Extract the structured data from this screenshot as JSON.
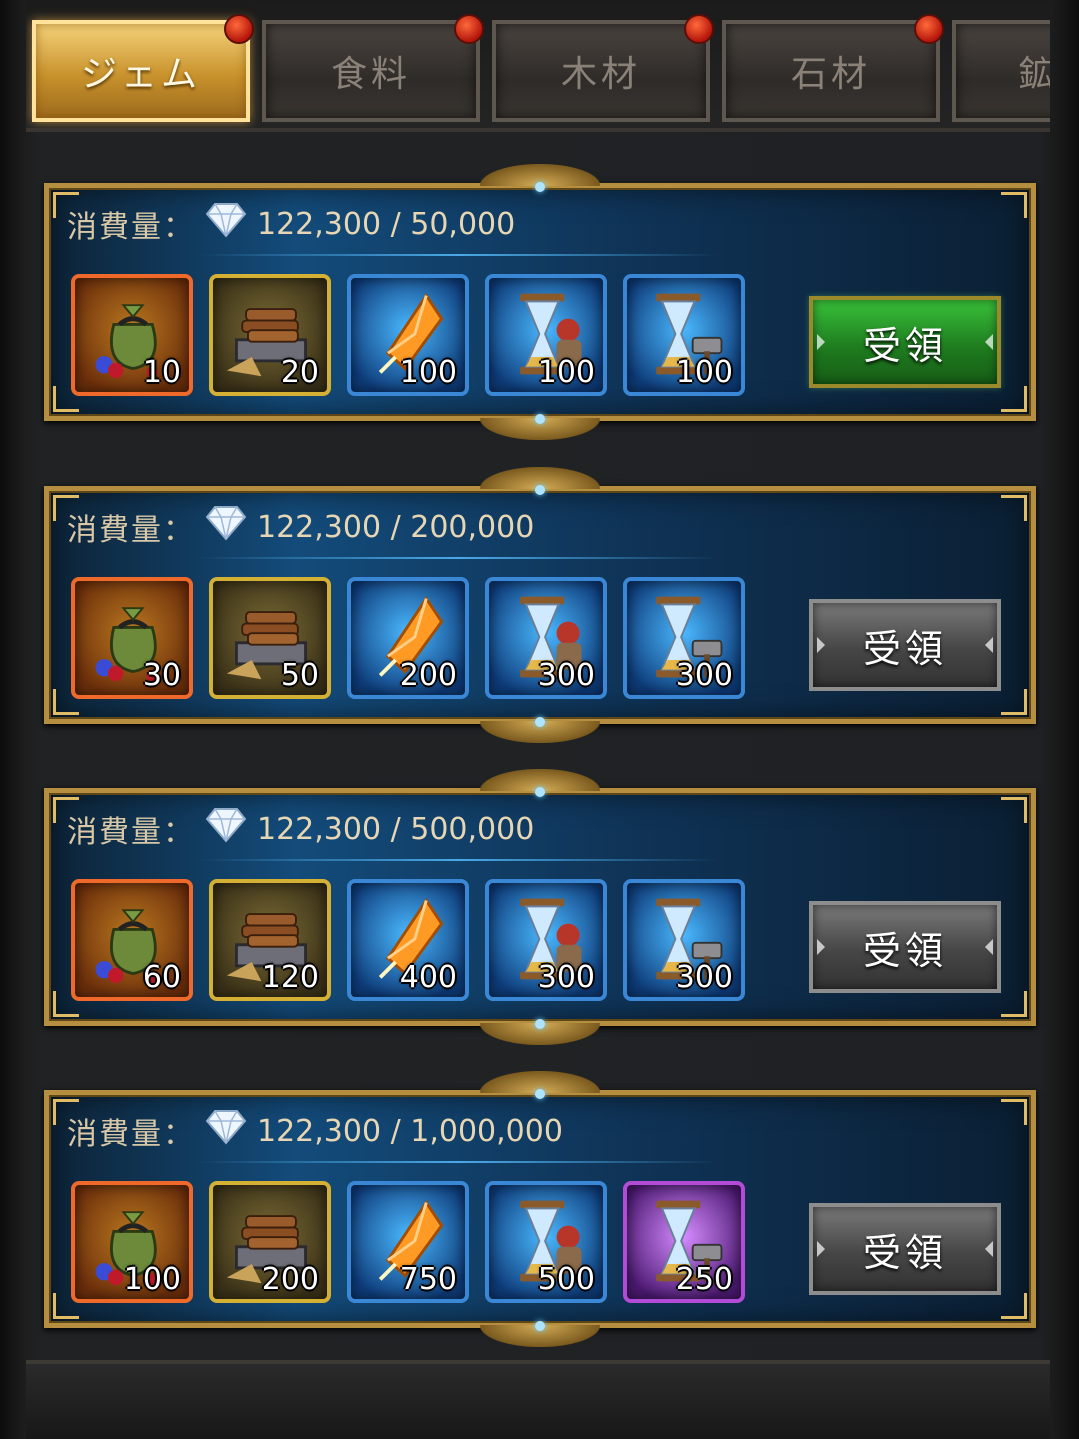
{
  "tabs": [
    {
      "label": "ジェム",
      "active": true,
      "badge": true
    },
    {
      "label": "食料",
      "active": false,
      "badge": true
    },
    {
      "label": "木材",
      "active": false,
      "badge": true
    },
    {
      "label": "石材",
      "active": false,
      "badge": true
    },
    {
      "label": "鉱",
      "active": false,
      "badge": false
    }
  ],
  "consume_label": "消費量：",
  "claim_label": "受領",
  "tiers": [
    {
      "progress": "122,300 / 50,000",
      "claim_enabled": true,
      "rewards": [
        {
          "icon": "resource-bag-icon",
          "rarity": "orange",
          "qty": "10"
        },
        {
          "icon": "lumber-cart-icon",
          "rarity": "gold",
          "qty": "20"
        },
        {
          "icon": "orange-crystal-icon",
          "rarity": "blue",
          "qty": "100"
        },
        {
          "icon": "training-speedup-hourglass-icon",
          "rarity": "blue",
          "qty": "100"
        },
        {
          "icon": "building-speedup-hourglass-icon",
          "rarity": "blue",
          "qty": "100"
        }
      ]
    },
    {
      "progress": "122,300 / 200,000",
      "claim_enabled": false,
      "rewards": [
        {
          "icon": "resource-bag-icon",
          "rarity": "orange",
          "qty": "30"
        },
        {
          "icon": "lumber-cart-icon",
          "rarity": "gold",
          "qty": "50"
        },
        {
          "icon": "orange-crystal-icon",
          "rarity": "blue",
          "qty": "200"
        },
        {
          "icon": "training-speedup-hourglass-icon",
          "rarity": "blue",
          "qty": "300"
        },
        {
          "icon": "building-speedup-hourglass-icon",
          "rarity": "blue",
          "qty": "300"
        }
      ]
    },
    {
      "progress": "122,300 / 500,000",
      "claim_enabled": false,
      "rewards": [
        {
          "icon": "resource-bag-icon",
          "rarity": "orange",
          "qty": "60"
        },
        {
          "icon": "lumber-cart-icon",
          "rarity": "gold",
          "qty": "120"
        },
        {
          "icon": "orange-crystal-icon",
          "rarity": "blue",
          "qty": "400"
        },
        {
          "icon": "training-speedup-hourglass-icon",
          "rarity": "blue",
          "qty": "300"
        },
        {
          "icon": "building-speedup-hourglass-icon",
          "rarity": "blue",
          "qty": "300"
        }
      ]
    },
    {
      "progress": "122,300 / 1,000,000",
      "claim_enabled": false,
      "rewards": [
        {
          "icon": "resource-bag-icon",
          "rarity": "orange",
          "qty": "100"
        },
        {
          "icon": "lumber-cart-icon",
          "rarity": "gold",
          "qty": "200"
        },
        {
          "icon": "orange-crystal-icon",
          "rarity": "blue",
          "qty": "750"
        },
        {
          "icon": "training-speedup-hourglass-icon",
          "rarity": "blue",
          "qty": "500"
        },
        {
          "icon": "building-speedup-hourglass-icon",
          "rarity": "purple",
          "qty": "250"
        }
      ]
    }
  ],
  "colors": {
    "tab_active": "#c8922c",
    "card_border": "#b58f3f",
    "claim_enabled": "#1f7d1f",
    "claim_disabled": "#464646"
  }
}
